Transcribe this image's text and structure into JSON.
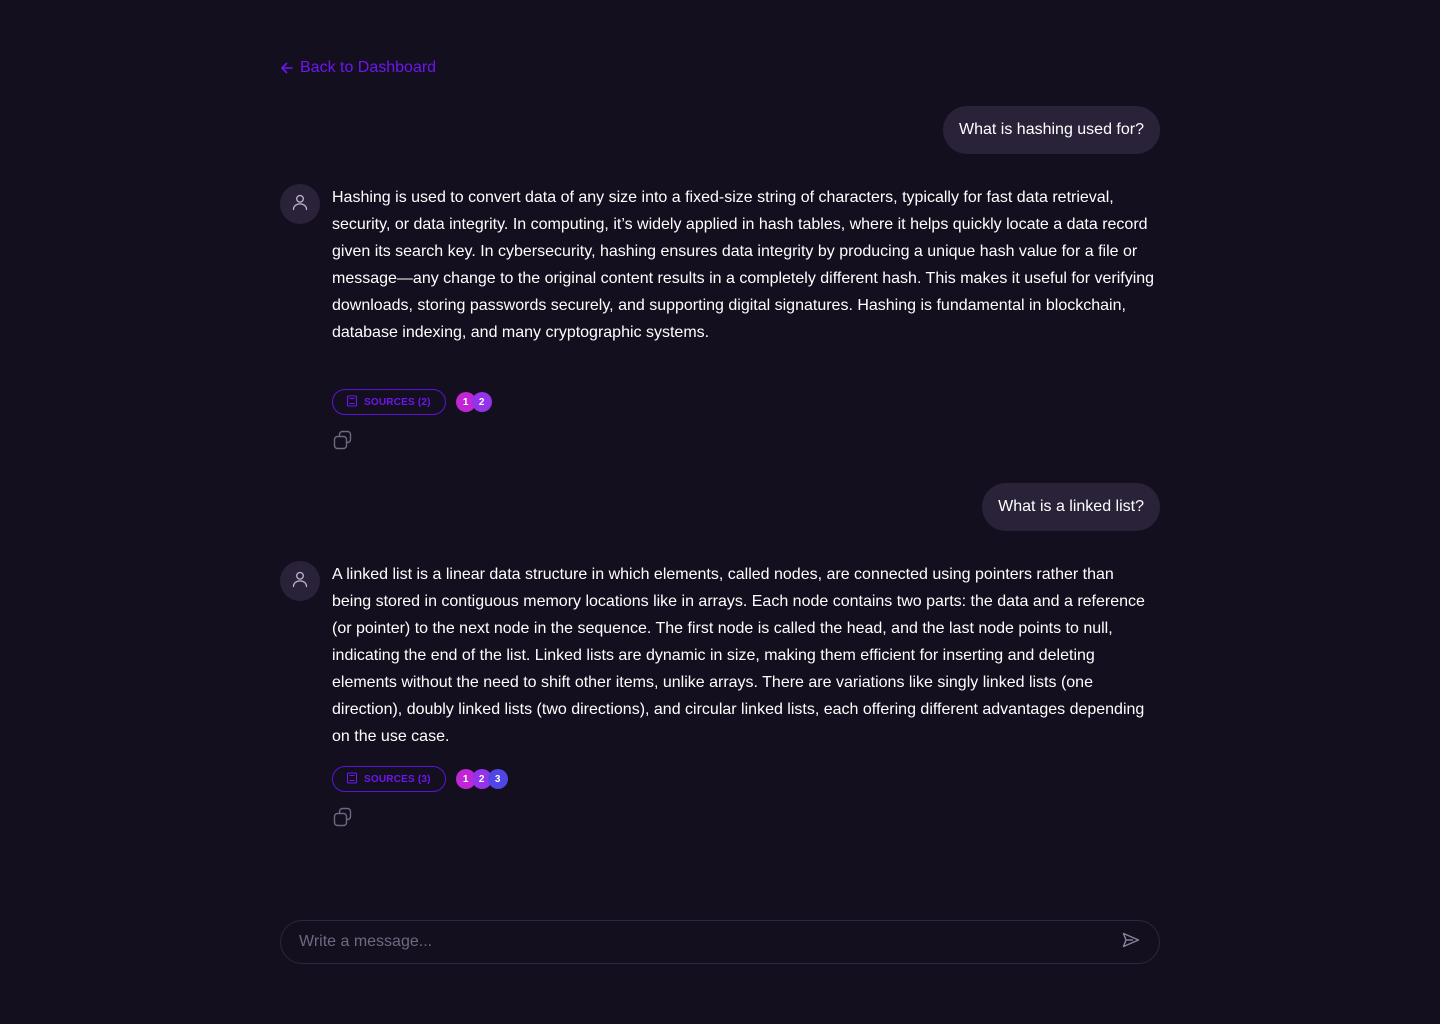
{
  "nav": {
    "back_label": "Back to Dashboard"
  },
  "conversation": [
    {
      "question": "What is hashing used for?",
      "answer": "Hashing is used to convert data of any size into a fixed-size string of characters, typically for fast data retrieval, security, or data integrity. In computing, it’s widely applied in hash tables, where it helps quickly locate a data record given its search key. In cybersecurity, hashing ensures data integrity by producing a unique hash value for a file or message—any change to the original content results in a completely different hash. This makes it useful for verifying downloads, storing passwords securely, and supporting digital signatures. Hashing is fundamental in blockchain, database indexing, and many cryptographic systems.",
      "sources_label": "SOURCES (2)",
      "source_numbers": [
        "1",
        "2"
      ]
    },
    {
      "question": "What is a linked list?",
      "answer": "A linked list is a linear data structure in which elements, called nodes, are connected using pointers rather than being stored in contiguous memory locations like in arrays. Each node contains two parts: the data and a reference (or pointer) to the next node in the sequence. The first node is called the head, and the last node points to null, indicating the end of the list. Linked lists are dynamic in size, making them efficient for inserting and deleting elements without the need to shift other items, unlike arrays. There are variations like singly linked lists (one direction), doubly linked lists (two directions), and circular linked lists, each offering different advantages depending on the use case.",
      "sources_label": "SOURCES (3)",
      "source_numbers": [
        "1",
        "2",
        "3"
      ]
    }
  ],
  "composer": {
    "placeholder": "Write a message..."
  },
  "colors": {
    "background": "#140f1e",
    "accent": "#6d16f0",
    "bubble": "#2a2238",
    "source_dots": [
      "#c026d3",
      "#9333ea",
      "#4f46e5"
    ]
  },
  "icons": {
    "back": "arrow-left-icon",
    "avatar": "user-icon",
    "sources": "book-icon",
    "copy": "copy-icon",
    "send": "send-icon"
  }
}
